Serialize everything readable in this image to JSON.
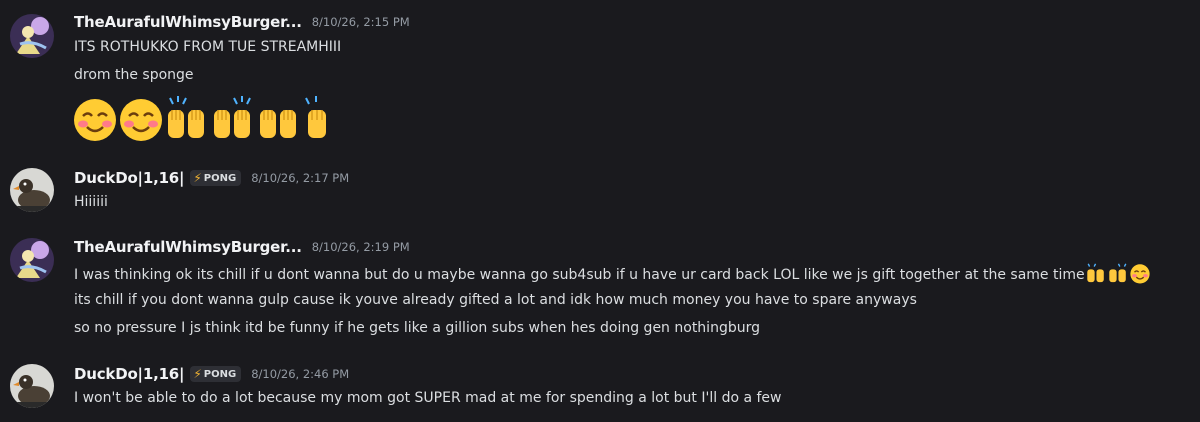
{
  "messages": [
    {
      "username": "TheAurafulWhimsyBurger...",
      "timestamp": "8/10/26, 2:15 PM",
      "avatar": "whimsy-avatar",
      "lines": [
        "ITS ROTHUKKO FROM TUE STREAMHIII",
        "drom the sponge"
      ],
      "emojis": [
        "blush-emoji",
        "blush-emoji",
        "raised-hands-emoji",
        "raised-hands-emoji",
        "raised-hands-emoji",
        "raised-hand-emoji"
      ]
    },
    {
      "username": "DuckDo|1,16|",
      "tag": "PONG",
      "timestamp": "8/10/26, 2:17 PM",
      "avatar": "duck-avatar",
      "lines": [
        "Hiiiiii"
      ]
    },
    {
      "username": "TheAurafulWhimsyBurger...",
      "timestamp": "8/10/26, 2:19 PM",
      "avatar": "whimsy-avatar",
      "lines": [
        "I was thinking ok its chill if u dont wanna but do u maybe wanna go sub4sub if u have ur card back LOL like we js gift together at the same time",
        "its chill if you dont wanna gulp cause ik youve already gifted a lot and idk how much money you have to spare anyways",
        "so no pressure I js think itd be funny if he gets like a gillion subs when hes doing gen nothingburg"
      ]
    },
    {
      "username": "DuckDo|1,16|",
      "tag": "PONG",
      "timestamp": "8/10/26, 2:46 PM",
      "avatar": "duck-avatar",
      "lines": [
        "I won't be able to do a lot because my mom got SUPER mad at me for spending a lot but I'll do a few"
      ]
    }
  ]
}
